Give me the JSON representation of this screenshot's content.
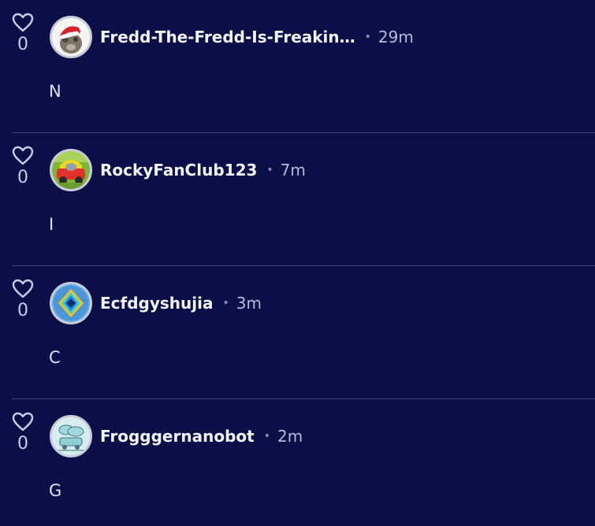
{
  "comments": [
    {
      "likes": "0",
      "username": "Fredd-The-Fredd-Is-Freakin…",
      "time": "29m",
      "text": "N",
      "avatar_icon": "dog-santa-hat-avatar"
    },
    {
      "likes": "0",
      "username": "RockyFanClub123",
      "time": "7m",
      "text": "I",
      "avatar_icon": "toy-car-avatar"
    },
    {
      "likes": "0",
      "username": "Ecfdgyshujia",
      "time": "3m",
      "text": "C",
      "avatar_icon": "blue-diamond-avatar"
    },
    {
      "likes": "0",
      "username": "Frogggernanobot",
      "time": "2m",
      "text": "G",
      "avatar_icon": "cloud-sketch-avatar"
    }
  ],
  "separator": "•",
  "colors": {
    "background": "#0a0f48",
    "divider": "#3a4076",
    "username": "#f3f4fb",
    "muted": "#b7bbd6"
  }
}
